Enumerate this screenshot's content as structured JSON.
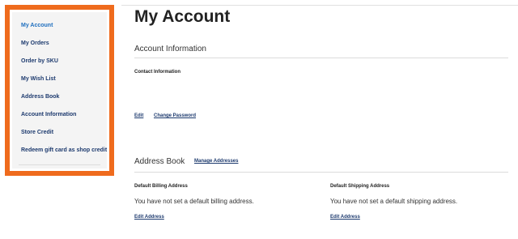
{
  "sidebar": {
    "items": [
      {
        "label": "My Account",
        "active": true
      },
      {
        "label": "My Orders"
      },
      {
        "label": "Order by SKU"
      },
      {
        "label": "My Wish List"
      },
      {
        "label": "Address Book"
      },
      {
        "label": "Account Information"
      },
      {
        "label": "Store Credit"
      },
      {
        "label": "Redeem gift card as shop credit"
      }
    ]
  },
  "main": {
    "title": "My Account",
    "account_info": {
      "heading": "Account Information",
      "contact_label": "Contact Information",
      "edit_link": "Edit",
      "change_password_link": "Change Password"
    },
    "address_book": {
      "heading": "Address Book",
      "manage_link": "Manage Addresses",
      "billing": {
        "label": "Default Billing Address",
        "text": "You have not set a default billing address.",
        "edit_link": "Edit Address"
      },
      "shipping": {
        "label": "Default Shipping Address",
        "text": "You have not set a default shipping address.",
        "edit_link": "Edit Address"
      }
    }
  },
  "colors": {
    "highlight_border": "#ef6b1d",
    "link": "#1d3a6e",
    "active_link": "#1f6fbf"
  }
}
